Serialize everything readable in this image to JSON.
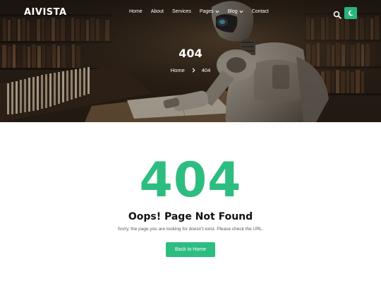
{
  "brand": {
    "logo": "AIVISTA",
    "accent": "#2ebd81"
  },
  "nav": {
    "items": [
      {
        "label": "Home",
        "dropdown": false
      },
      {
        "label": "About",
        "dropdown": false
      },
      {
        "label": "Services",
        "dropdown": false
      },
      {
        "label": "Pages",
        "dropdown": true
      },
      {
        "label": "Blog",
        "dropdown": true
      },
      {
        "label": "Contact",
        "dropdown": false
      }
    ],
    "search_icon": "search-icon",
    "theme_toggle_icon": "moon-icon"
  },
  "hero": {
    "title": "404",
    "breadcrumb": {
      "home": "Home",
      "separator_icon": "chevron-right-icon",
      "current": "404"
    }
  },
  "error": {
    "code": "404",
    "title": "Oops! Page Not Found",
    "message": "Sorry, the page you are looking for doesn't exist. Please check the URL.",
    "button_label": "Back to Home"
  }
}
